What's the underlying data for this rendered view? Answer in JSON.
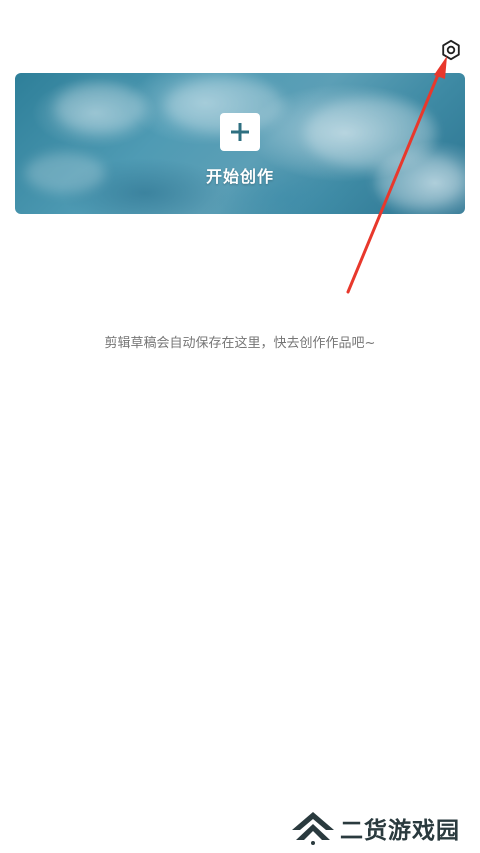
{
  "toolbar": {
    "settings_icon": "gear-icon"
  },
  "start_card": {
    "label": "开始创作",
    "plus_icon": "plus-icon"
  },
  "empty_state": {
    "hint": "剪辑草稿会自动保存在这里，快去创作作品吧~"
  },
  "watermark": {
    "text": "二货游戏园"
  },
  "colors": {
    "annotation_arrow": "#e8382c",
    "card_accent": "#3e8aa4",
    "plus_icon": "#2e6f80",
    "hint_text": "#757575"
  }
}
